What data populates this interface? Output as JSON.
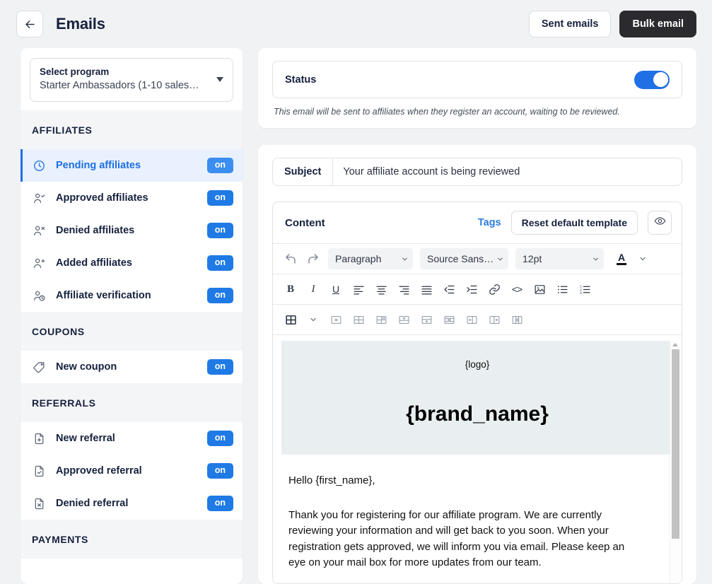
{
  "header": {
    "back_icon": "arrow-left-icon",
    "title": "Emails",
    "sent_emails_label": "Sent emails",
    "bulk_email_label": "Bulk email"
  },
  "sidebar": {
    "program_select": {
      "label": "Select program",
      "value": "Starter Ambassadors (1-10 sales…",
      "caret_icon": "chevron-down-icon"
    },
    "groups": [
      {
        "title": "AFFILIATES",
        "items": [
          {
            "label": "Pending affiliates",
            "icon": "clock-icon",
            "badge": "on",
            "active": true
          },
          {
            "label": "Approved affiliates",
            "icon": "user-check-icon",
            "badge": "on",
            "active": false
          },
          {
            "label": "Denied affiliates",
            "icon": "user-x-icon",
            "badge": "on",
            "active": false
          },
          {
            "label": "Added affiliates",
            "icon": "user-plus-icon",
            "badge": "on",
            "active": false
          },
          {
            "label": "Affiliate verification",
            "icon": "user-clock-icon",
            "badge": "on",
            "active": false
          }
        ]
      },
      {
        "title": "COUPONS",
        "items": [
          {
            "label": "New coupon",
            "icon": "tag-icon",
            "badge": "on",
            "active": false
          }
        ]
      },
      {
        "title": "REFERRALS",
        "items": [
          {
            "label": "New referral",
            "icon": "file-plus-icon",
            "badge": "on",
            "active": false
          },
          {
            "label": "Approved referral",
            "icon": "file-check-icon",
            "badge": "on",
            "active": false
          },
          {
            "label": "Denied referral",
            "icon": "file-x-icon",
            "badge": "on",
            "active": false
          }
        ]
      },
      {
        "title": "PAYMENTS",
        "items": []
      }
    ]
  },
  "status_panel": {
    "label": "Status",
    "toggle_on": true,
    "hint": "This email will be sent to affiliates when they register an account, waiting to be reviewed."
  },
  "subject": {
    "label": "Subject",
    "value": "Your affiliate account is being reviewed"
  },
  "content_panel": {
    "title": "Content",
    "tags_label": "Tags",
    "reset_label": "Reset default template",
    "preview_icon": "eye-icon"
  },
  "toolbar": {
    "undo_icon": "undo-icon",
    "redo_icon": "redo-icon",
    "block_format": "Paragraph",
    "font_family": "Source Sans…",
    "font_size": "12pt",
    "text_color_glyph": "A",
    "text_color_hex": "#111111",
    "format_buttons": [
      {
        "name": "bold-icon",
        "glyph": "B"
      },
      {
        "name": "italic-icon",
        "glyph": "I"
      },
      {
        "name": "underline-icon",
        "glyph": "U"
      },
      {
        "name": "align-left-icon",
        "glyph": ""
      },
      {
        "name": "align-center-icon",
        "glyph": ""
      },
      {
        "name": "align-right-icon",
        "glyph": ""
      },
      {
        "name": "align-justify-icon",
        "glyph": ""
      },
      {
        "name": "outdent-icon",
        "glyph": ""
      },
      {
        "name": "indent-icon",
        "glyph": ""
      },
      {
        "name": "link-icon",
        "glyph": ""
      },
      {
        "name": "source-code-icon",
        "glyph": "<>"
      },
      {
        "name": "insert-image-icon",
        "glyph": ""
      },
      {
        "name": "bullet-list-icon",
        "glyph": ""
      },
      {
        "name": "numbered-list-icon",
        "glyph": ""
      }
    ],
    "table_buttons": [
      {
        "name": "table-icon"
      },
      {
        "name": "table-menu-chevron-icon"
      },
      {
        "name": "table-delete-icon"
      },
      {
        "name": "table-properties-icon"
      },
      {
        "name": "table-cell-properties-icon"
      },
      {
        "name": "table-insert-row-above-icon"
      },
      {
        "name": "table-insert-row-below-icon"
      },
      {
        "name": "table-delete-row-icon"
      },
      {
        "name": "table-insert-column-before-icon"
      },
      {
        "name": "table-insert-column-after-icon"
      },
      {
        "name": "table-delete-column-icon"
      }
    ]
  },
  "email_preview": {
    "logo_placeholder": "{logo}",
    "brand_name": "{brand_name}",
    "greeting": "Hello {first_name},",
    "body": "Thank you for registering for our affiliate program. We are currently reviewing your information and will get back to you soon. When your registration gets approved, we will inform you via email. Please keep an eye on your mail box for more updates from our team."
  },
  "colors": {
    "accent": "#1f6fe5",
    "badge": "#1f7ae5",
    "badge_active": "#3b8ef0",
    "dark_button": "#2b2b2f",
    "page_bg": "#f1f2f4",
    "hero_bg": "#e9eff0"
  }
}
